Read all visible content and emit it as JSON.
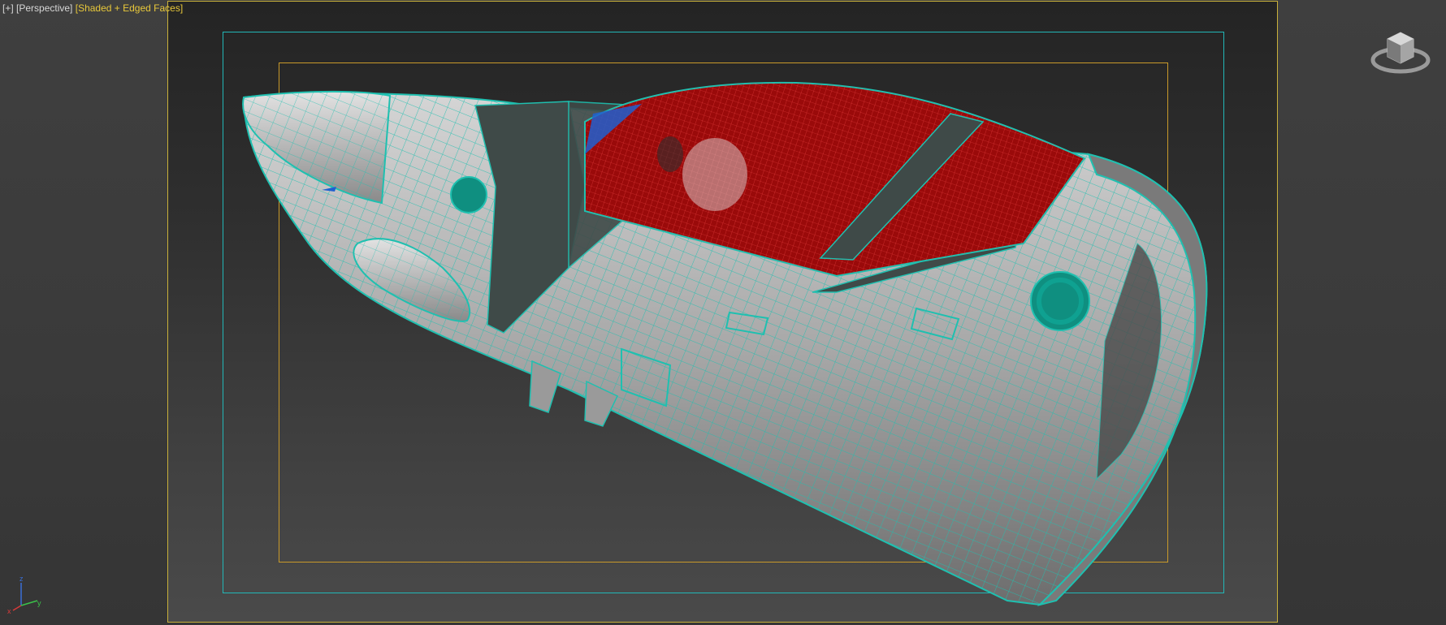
{
  "viewport": {
    "label_plus": "[+]",
    "label_view": "[Perspective]",
    "label_shading": "[Shaded + Edged Faces]"
  },
  "colors": {
    "wire": "#1fc0b0",
    "canopy": "#9a0a0a",
    "hull": "#a9a9a9",
    "render_frame": "#c9b13a",
    "safe_frame": "#22b7b7",
    "action_frame": "#c99a2a"
  },
  "icons": {
    "viewcube": "viewcube-icon",
    "axis": "axis-tripod-icon"
  },
  "axes": {
    "x": "x",
    "y": "y",
    "z": "z"
  }
}
